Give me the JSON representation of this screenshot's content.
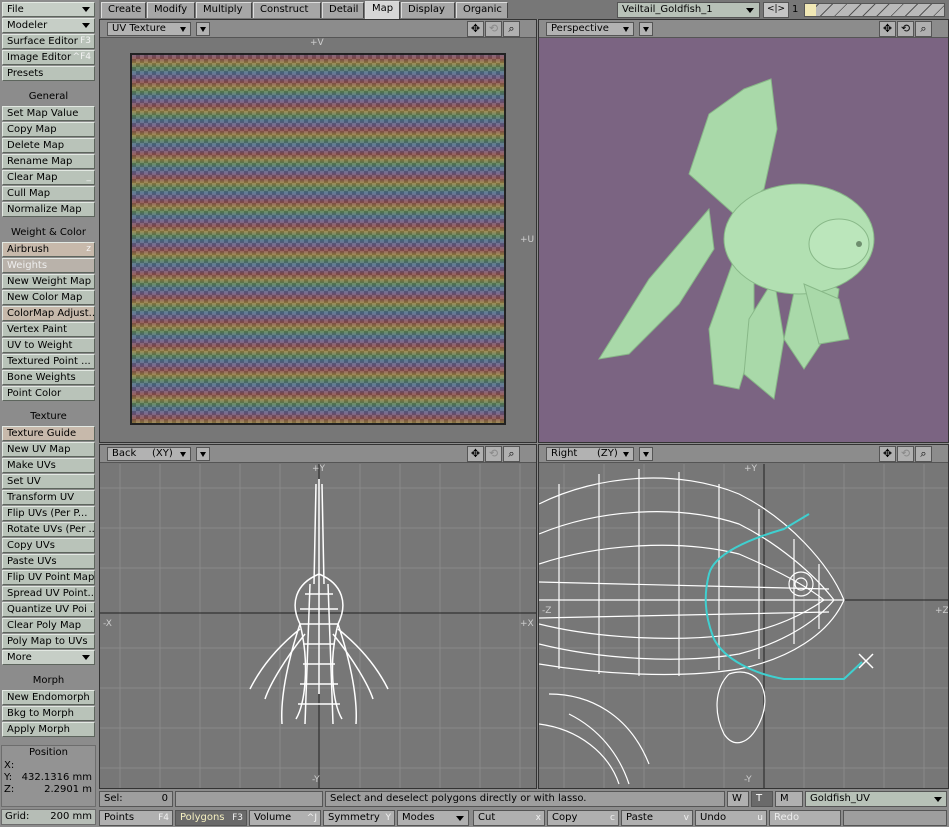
{
  "sidebar": {
    "file": "File",
    "modeler": "Modeler",
    "surface_editor": {
      "label": "Surface Editor",
      "shortcut": "F3"
    },
    "image_editor": {
      "label": "Image Editor",
      "shortcut": "^F4"
    },
    "presets": "Presets",
    "general_head": "General",
    "set_map_value": "Set Map Value",
    "copy_map": "Copy Map",
    "delete_map": "Delete Map",
    "rename_map": "Rename Map",
    "clear_map": {
      "label": "Clear Map",
      "shortcut": "_"
    },
    "cull_map": "Cull Map",
    "normalize_map": "Normalize Map",
    "weight_head": "Weight & Color",
    "airbrush": {
      "label": "Airbrush",
      "shortcut": "z"
    },
    "weights": "Weights",
    "new_weight_map": "New Weight Map",
    "new_color_map": "New Color Map",
    "colormap_adjust": "ColorMap Adjust...",
    "vertex_paint": "Vertex Paint",
    "uv_to_weight": "UV to Weight",
    "textured_point": "Textured Point ...",
    "bone_weights": "Bone Weights",
    "point_color": "Point Color",
    "texture_head": "Texture",
    "texture_guide": "Texture Guide",
    "new_uv_map": "New UV Map",
    "make_uvs": "Make UVs",
    "set_uv": "Set UV",
    "transform_uv": "Transform UV",
    "flip_uvs": "Flip UVs (Per P...",
    "rotate_uvs": "Rotate UVs (Per ...",
    "copy_uvs": "Copy UVs",
    "paste_uvs": "Paste UVs",
    "flip_uv_point_map": "Flip UV Point Map",
    "spread_uv_point": "Spread UV Point...",
    "quantize_uv": "Quantize UV Poi ...",
    "clear_poly_map": "Clear Poly Map",
    "poly_map_to_uvs": "Poly Map to UVs",
    "more": "More",
    "morph_head": "Morph",
    "new_endomorph": "New Endomorph",
    "bkg_to_morph": "Bkg to Morph",
    "apply_morph": "Apply Morph",
    "position_head": "Position",
    "x_label": "X:",
    "x_value": "",
    "y_label": "Y:",
    "y_value": "432.1316 mm",
    "z_label": "Z:",
    "z_value": "2.2901 m",
    "grid_label": "Grid:",
    "grid_value": "200 mm"
  },
  "tabs": [
    "Create",
    "Modify",
    "Multiply",
    "Construct",
    "Detail",
    "Map",
    "Display",
    "Organic"
  ],
  "active_tab": "Map",
  "object": "Veiltail_Goldfish_1",
  "layer_nav": "<|>",
  "layer_number": "1",
  "viewports": {
    "uv": {
      "mode": "UV Texture",
      "top_label": "+V",
      "right_label": "+U"
    },
    "persp": {
      "mode": "Perspective"
    },
    "back": {
      "mode": "Back",
      "axes": "(XY)",
      "top_label": "+Y",
      "left_label": "-X",
      "right_label": "+X",
      "bottom_label": "-Y"
    },
    "right": {
      "mode": "Right",
      "axes": "(ZY)",
      "top_label": "+Y",
      "left_label": "-Z",
      "right_label": "+Z",
      "bottom_label": "-Y"
    }
  },
  "icons": {
    "move": "move-view-icon",
    "rotate": "rotate-view-icon",
    "zoom": "zoom-view-icon"
  },
  "status": {
    "sel_label": "Sel:",
    "sel_value": "0",
    "message": "Select and deselect polygons directly or with lasso.",
    "w": "W",
    "t": "T",
    "m": "M",
    "uvmap": "Goldfish_UV"
  },
  "toolbar": {
    "points": {
      "label": "Points",
      "shortcut": "F4"
    },
    "polygons": {
      "label": "Polygons",
      "shortcut": "F3"
    },
    "volume": {
      "label": "Volume",
      "shortcut": "^J"
    },
    "symmetry": {
      "label": "Symmetry",
      "shortcut": "Y"
    },
    "modes": "Modes",
    "cut": {
      "label": "Cut",
      "shortcut": "x"
    },
    "copy": {
      "label": "Copy",
      "shortcut": "c"
    },
    "paste": {
      "label": "Paste",
      "shortcut": "v"
    },
    "undo": {
      "label": "Undo",
      "shortcut": "u"
    },
    "redo": "Redo"
  },
  "colors": {
    "persp_bg": "#7b6482",
    "fish": "#a8d8a8",
    "wire": "#ffffff",
    "path": "#3fd0d0",
    "uv_bg": "#2b2b2b"
  }
}
